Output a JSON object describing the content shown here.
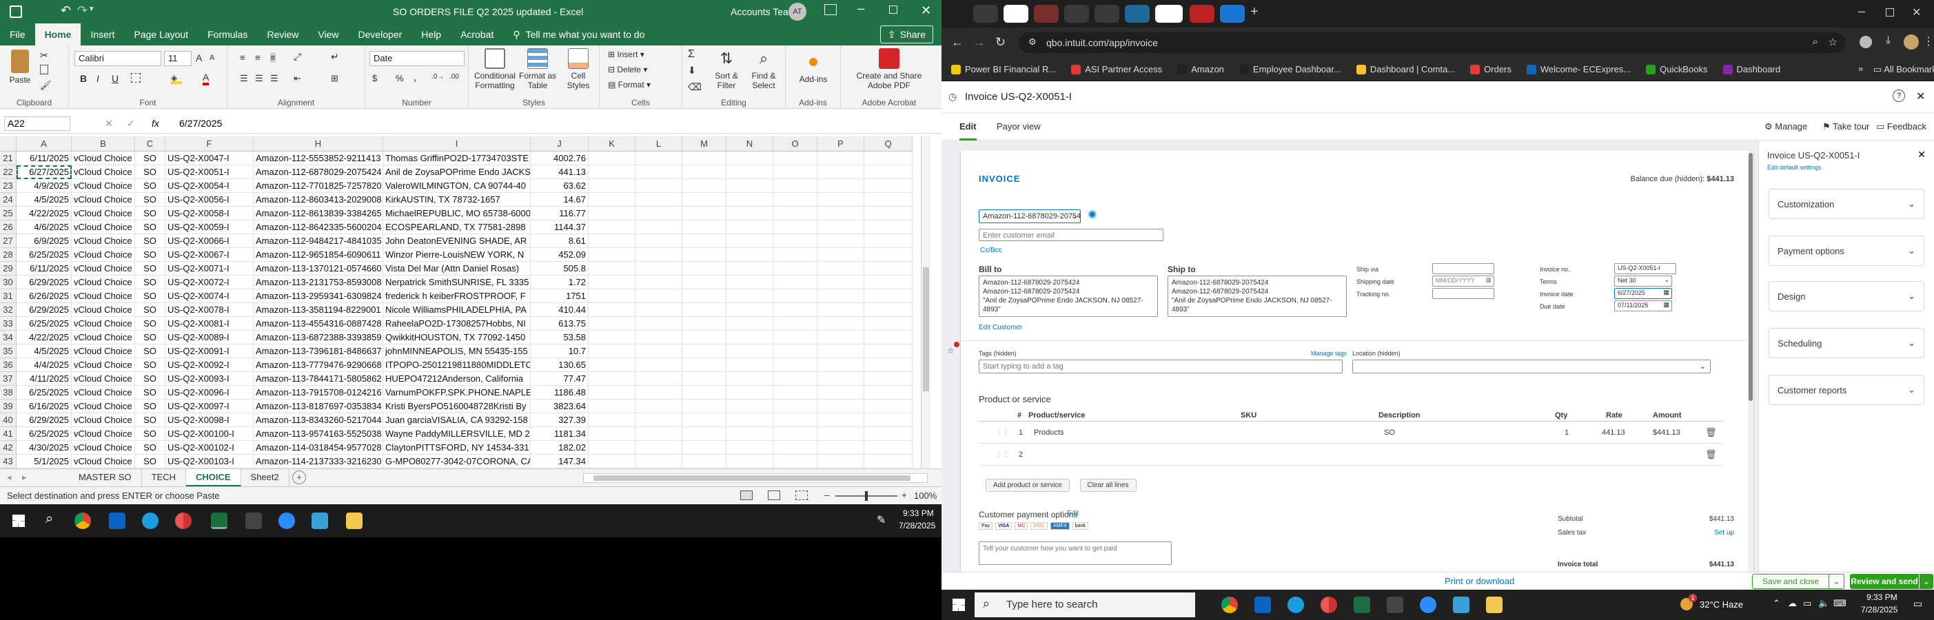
{
  "excel": {
    "title": "SO ORDERS FILE Q2 2025 updated  -  Excel",
    "account": "Accounts Team",
    "avatar": "AT",
    "menu": [
      "File",
      "Home",
      "Insert",
      "Page Layout",
      "Formulas",
      "Review",
      "View",
      "Developer",
      "Help",
      "Acrobat"
    ],
    "tell_me": "Tell me what you want to do",
    "share": "Share",
    "ribbon": {
      "paste": "Paste",
      "clipboard": "Clipboard",
      "font_name": "Calibri",
      "font_size": "11",
      "font_group": "Font",
      "alignment": "Alignment",
      "number_format": "Date",
      "number": "Number",
      "conditional": "Conditional Formatting",
      "format_table": "Format as Table",
      "cell_styles": "Cell Styles",
      "styles": "Styles",
      "insert": "Insert",
      "delete": "Delete",
      "format": "Format",
      "cells": "Cells",
      "sort": "Sort & Filter",
      "find": "Find & Select",
      "editing": "Editing",
      "addins": "Add-ins",
      "addins_group": "Add-ins",
      "create_pdf": "Create and Share Adobe PDF",
      "acrobat_group": "Adobe Acrobat",
      "bold": "B",
      "italic": "I",
      "underline": "U",
      "percent": "%",
      "comma": ","
    },
    "name_box": "A22",
    "fx": "fx",
    "formula_value": "6/27/2025",
    "columns": [
      "A",
      "B",
      "C",
      "D",
      "E",
      "F",
      "G",
      "H",
      "I",
      "J",
      "K",
      "L",
      "M",
      "N",
      "O",
      "P",
      "Q"
    ],
    "rows": [
      {
        "n": "21",
        "a": "6/11/2025",
        "b": "vCloud Choice",
        "c": "SO",
        "d": "US-Q2-X0047-I",
        "h": "Amazon-112-5553852-9211413",
        "i": "Thomas GriffinPO2D-17734703STE",
        "j": "4002.76"
      },
      {
        "n": "22",
        "a": "6/27/2025",
        "b": "vCloud Choice",
        "c": "SO",
        "d": "US-Q2-X0051-I",
        "h": "Amazon-112-6878029-2075424",
        "i": "Anil de ZoysaPOPrime Endo JACKS",
        "j": "441.13"
      },
      {
        "n": "23",
        "a": "4/9/2025",
        "b": "vCloud Choice",
        "c": "SO",
        "d": "US-Q2-X0054-I",
        "h": "Amazon-112-7701825-7257820",
        "i": "ValeroWILMINGTON, CA 90744-40",
        "j": "63.62"
      },
      {
        "n": "24",
        "a": "4/5/2025",
        "b": "vCloud Choice",
        "c": "SO",
        "d": "US-Q2-X0056-I",
        "h": "Amazon-112-8603413-2029008",
        "i": "KirkAUSTIN, TX 78732-1657",
        "j": "14.67"
      },
      {
        "n": "25",
        "a": "4/22/2025",
        "b": "vCloud Choice",
        "c": "SO",
        "d": "US-Q2-X0058-I",
        "h": "Amazon-112-8613839-3384265",
        "i": "MichaelREPUBLIC, MO 65738-6000",
        "j": "116.77"
      },
      {
        "n": "26",
        "a": "4/6/2025",
        "b": "vCloud Choice",
        "c": "SO",
        "d": "US-Q2-X0059-I",
        "h": "Amazon-112-8642335-5600204",
        "i": "ECOSPEARLAND, TX 77581-2898",
        "j": "1144.37"
      },
      {
        "n": "27",
        "a": "6/9/2025",
        "b": "vCloud Choice",
        "c": "SO",
        "d": "US-Q2-X0066-I",
        "h": "Amazon-112-9484217-4841035",
        "i": "John DeatonEVENING SHADE, AR",
        "j": "8.61"
      },
      {
        "n": "28",
        "a": "6/25/2025",
        "b": "vCloud Choice",
        "c": "SO",
        "d": "US-Q2-X0067-I",
        "h": "Amazon-112-9651854-6090611",
        "i": "Winzor Pierre-LouisNEW YORK, N",
        "j": "452.09"
      },
      {
        "n": "29",
        "a": "6/11/2025",
        "b": "vCloud Choice",
        "c": "SO",
        "d": "US-Q2-X0071-I",
        "h": "Amazon-113-1370121-0574660",
        "i": "Vista Del Mar (Attn Daniel Rosas)",
        "j": "505.8"
      },
      {
        "n": "30",
        "a": "6/29/2025",
        "b": "vCloud Choice",
        "c": "SO",
        "d": "US-Q2-X0072-I",
        "h": "Amazon-113-2131753-8593008",
        "i": "Nerpatrick SmithSUNRISE, FL 3335",
        "j": "1.72"
      },
      {
        "n": "31",
        "a": "6/26/2025",
        "b": "vCloud Choice",
        "c": "SO",
        "d": "US-Q2-X0074-I",
        "h": "Amazon-113-2959341-6309824",
        "i": "frederick h keiberFROSTPROOF, F",
        "j": "1751"
      },
      {
        "n": "32",
        "a": "6/29/2025",
        "b": "vCloud Choice",
        "c": "SO",
        "d": "US-Q2-X0078-I",
        "h": "Amazon-113-3581194-8229001",
        "i": "Nicole WilliamsPHILADELPHIA, PA",
        "j": "410.44"
      },
      {
        "n": "33",
        "a": "6/25/2025",
        "b": "vCloud Choice",
        "c": "SO",
        "d": "US-Q2-X0081-I",
        "h": "Amazon-113-4554316-0887428",
        "i": "RaheelaPO2D-17308257Hobbs, NI",
        "j": "613.75"
      },
      {
        "n": "34",
        "a": "4/22/2025",
        "b": "vCloud Choice",
        "c": "SO",
        "d": "US-Q2-X0089-I",
        "h": "Amazon-113-6872388-3393859",
        "i": "QwikkitHOUSTON, TX 77092-1450",
        "j": "53.58"
      },
      {
        "n": "35",
        "a": "4/5/2025",
        "b": "vCloud Choice",
        "c": "SO",
        "d": "US-Q2-X0091-I",
        "h": "Amazon-113-7396181-8486637",
        "i": "johnMINNEAPOLIS, MN 55435-155",
        "j": "10.7"
      },
      {
        "n": "36",
        "a": "4/4/2025",
        "b": "vCloud Choice",
        "c": "SO",
        "d": "US-Q2-X0092-I",
        "h": "Amazon-113-7779476-9290668",
        "i": "ITPOPO-2501219811880MIDDLETC",
        "j": "130.65"
      },
      {
        "n": "37",
        "a": "4/11/2025",
        "b": "vCloud Choice",
        "c": "SO",
        "d": "US-Q2-X0093-I",
        "h": "Amazon-113-7844171-5805862",
        "i": "HUEPO47212Anderson, California",
        "j": "77.47"
      },
      {
        "n": "38",
        "a": "6/25/2025",
        "b": "vCloud Choice",
        "c": "SO",
        "d": "US-Q2-X0096-I",
        "h": "Amazon-113-7915708-0124216",
        "i": "VarnumPOKFP.SPK.PHONE.NAPLE",
        "j": "1186.48"
      },
      {
        "n": "39",
        "a": "6/16/2025",
        "b": "vCloud Choice",
        "c": "SO",
        "d": "US-Q2-X0097-I",
        "h": "Amazon-113-8187697-0353834",
        "i": "Kristi ByersPO5160048728Kristi By",
        "j": "3823.64"
      },
      {
        "n": "40",
        "a": "6/29/2025",
        "b": "vCloud Choice",
        "c": "SO",
        "d": "US-Q2-X0098-I",
        "h": "Amazon-113-8343260-5217044",
        "i": "Juan garciaVISALIA, CA 93292-158",
        "j": "327.39"
      },
      {
        "n": "41",
        "a": "6/25/2025",
        "b": "vCloud Choice",
        "c": "SO",
        "d": "US-Q2-X00100-I",
        "h": "Amazon-113-9574163-5525038",
        "i": "Wayne PaddyMILLERSVILLE, MD 2",
        "j": "1181.34"
      },
      {
        "n": "42",
        "a": "4/30/2025",
        "b": "vCloud Choice",
        "c": "SO",
        "d": "US-Q2-X00102-I",
        "h": "Amazon-114-0318454-9577028",
        "i": "ClaytonPITTSFORD, NY 14534-331",
        "j": "182.02"
      },
      {
        "n": "43",
        "a": "5/1/2025",
        "b": "vCloud Choice",
        "c": "SO",
        "d": "US-Q2-X00103-I",
        "h": "Amazon-114-2137333-3216230",
        "i": "G-MPO80277-3042-07CORONA, CA",
        "j": "147.34"
      }
    ],
    "sheets": [
      "MASTER SO",
      "TECH",
      "CHOICE",
      "Sheet2"
    ],
    "active_sheet": "CHOICE",
    "status_text": "Select destination and press ENTER or choose Paste",
    "zoom": "100%",
    "taskbar": {
      "time": "9:33 PM",
      "date": "7/28/2025"
    }
  },
  "browser": {
    "url": "qbo.intuit.com/app/invoice",
    "bookmarks": [
      "Power BI Financial R...",
      "ASI Partner Access",
      "Amazon",
      "Employee Dashboar...",
      "Dashboard | Comta...",
      "Orders",
      "Welcome- ECExpres...",
      "QuickBooks",
      "Dashboard"
    ],
    "all_bookmarks": "All Bookmarks",
    "invoice_title": "Invoice US-Q2-X0051-I",
    "subtabs": [
      "Edit",
      "Payor view"
    ],
    "manage": "Manage",
    "take_tour": "Take tour",
    "feedback": "Feedback",
    "card": {
      "heading": "INVOICE",
      "balance_label": "Balance due (hidden):",
      "balance_value": "$441.13",
      "customer": "Amazon-112-6878029-20754",
      "email_placeholder": "Enter customer email",
      "ccbcc": "Cc/Bcc",
      "bill_to": "Bill to",
      "ship_to": "Ship to",
      "address_lines": [
        "Amazon-112-6878029-2075424",
        "Amazon-112-6878029-2075424",
        "\"Anil de ZoysaPOPrime Endo JACKSON, NJ 08527-4893\""
      ],
      "edit_customer": "Edit Customer",
      "ship_via": "Ship via",
      "shipping_date": "Shipping date",
      "shipping_placeholder": "MM/DD/YYYY",
      "tracking_no": "Tracking no.",
      "invoice_no_label": "Invoice no.",
      "invoice_no": "US-Q2-X0051-I",
      "terms_label": "Terms",
      "terms": "Net 30",
      "invoice_date_label": "Invoice date",
      "invoice_date": "6/27/2025",
      "due_date_label": "Due date",
      "due_date": "07/11/2025",
      "tags_label": "Tags (hidden)",
      "manage_tags": "Manage tags",
      "tags_placeholder": "Start typing to add a tag",
      "location_label": "Location (hidden)",
      "product_heading": "Product or service",
      "cols": [
        "#",
        "Product/service",
        "SKU",
        "Description",
        "Qty",
        "Rate",
        "Amount"
      ],
      "lines": [
        {
          "n": "1",
          "product": "Products",
          "sku": "",
          "desc": "SO",
          "qty": "1",
          "rate": "441.13",
          "amount": "$441.13"
        },
        {
          "n": "2",
          "product": "",
          "sku": "",
          "desc": "",
          "qty": "",
          "rate": "",
          "amount": ""
        }
      ],
      "add_product": "Add product or service",
      "clear_lines": "Clear all lines",
      "payment_options": "Customer payment options",
      "edit": "Edit",
      "pay_brands": [
        "Pay",
        "VISA",
        "MC",
        "DISC",
        "AMEX",
        "bank"
      ],
      "subtotal_label": "Subtotal",
      "subtotal": "$441.13",
      "sales_tax": "Sales tax",
      "set_up": "Set up",
      "message_placeholder": "Tell your customer how you want to get paid",
      "invoice_total": "Invoice total",
      "invoice_total_value": "$441.13"
    },
    "side": {
      "title": "Invoice US-Q2-X0051-I",
      "edit_default": "Edit default settings",
      "sections": [
        "Customization",
        "Payment options",
        "Design",
        "Scheduling",
        "Customer reports"
      ]
    },
    "footer": {
      "print": "Print or download",
      "save_close": "Save and close",
      "review_send": "Review and send"
    },
    "taskbar": {
      "search": "Type here to search",
      "weather": "32°C  Haze",
      "time": "9:33 PM",
      "date": "7/28/2025",
      "badge": "1"
    }
  },
  "colors": {
    "excel_green": "#217346",
    "qbo_green": "#2ca01c",
    "qbo_link": "#0077c5"
  }
}
